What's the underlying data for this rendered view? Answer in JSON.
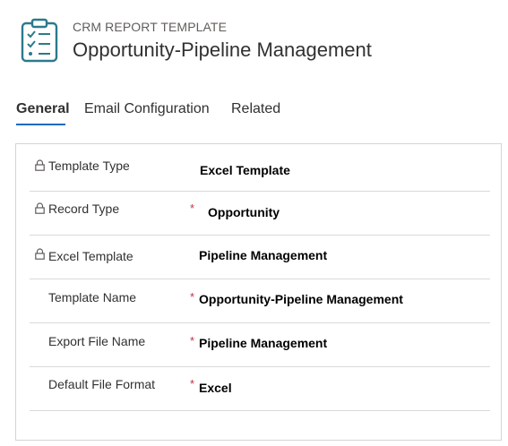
{
  "header": {
    "entity_type": "CRM REPORT TEMPLATE",
    "record_title": "Opportunity-Pipeline Management",
    "icon": "report-template-icon"
  },
  "tabs": [
    {
      "label": "General",
      "active": true
    },
    {
      "label": "Email Configuration",
      "active": false
    },
    {
      "label": "Related",
      "active": false
    }
  ],
  "form": {
    "rows": [
      {
        "label": "Template Type",
        "value": "Excel Template",
        "locked": true,
        "required": false
      },
      {
        "label": "Record Type",
        "value": "Opportunity",
        "locked": true,
        "required": true
      },
      {
        "label": "Excel Template",
        "value": "Pipeline Management",
        "locked": true,
        "required": false
      },
      {
        "label": "Template Name",
        "value": "Opportunity-Pipeline Management",
        "locked": false,
        "required": true
      },
      {
        "label": "Export File Name",
        "value": "Pipeline Management",
        "locked": false,
        "required": true
      },
      {
        "label": "Default File Format",
        "value": "Excel",
        "locked": false,
        "required": true
      }
    ],
    "required_marker": "*"
  },
  "colors": {
    "accent": "#0f6cbd",
    "required": "#c4314b",
    "icon": "#2b7a8c"
  }
}
